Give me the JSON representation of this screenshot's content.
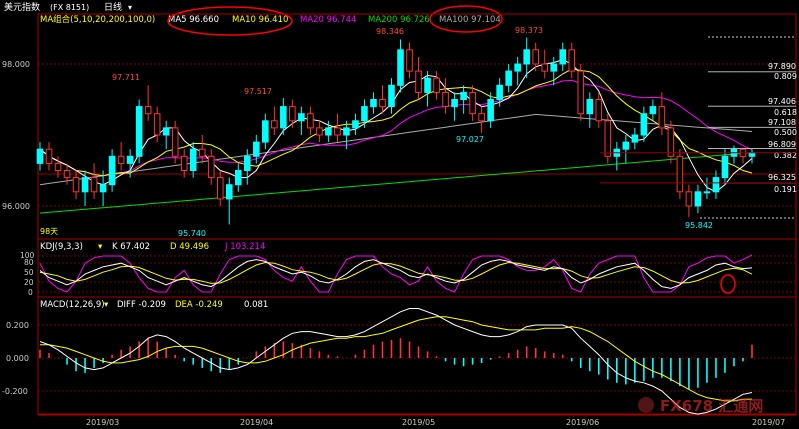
{
  "header": {
    "title": "美元指数",
    "code": "(FX 8151)",
    "period": "日线",
    "period_arrow": "▾"
  },
  "ma_legend": {
    "label": "MA组合(5,10,20,200,100,0)",
    "items": [
      {
        "text": "MA5 96.660",
        "color": "#ffffff"
      },
      {
        "text": "MA10 96.410",
        "color": "#ffff00"
      },
      {
        "text": "MA20 96.744",
        "color": "#ff00ff"
      },
      {
        "text": "MA200 96.726",
        "color": "#00dd00"
      },
      {
        "text": "MA100 97.104",
        "color": "#aaaaaa"
      }
    ]
  },
  "colors": {
    "up": "#00ffff",
    "down": "#ff3333",
    "ma5": "#ffffff",
    "ma10": "#ffff00",
    "ma20": "#ff00ff",
    "ma200": "#00dd00",
    "ma100": "#aaaaaa",
    "grid": "#7a0000",
    "border": "#aa0000",
    "circle": "#ff0000",
    "watermark": "#ff3333"
  },
  "fib_labels": [
    "97.890",
    "0.809",
    "97.406",
    "0.618",
    "97.108",
    "0.500",
    "96.809",
    "0.382",
    "96.325",
    "0.191"
  ],
  "annotations": [
    "98.346",
    "98.373",
    "97.711",
    "97.517",
    "97.027",
    "95.740",
    "95.842",
    "98天"
  ],
  "price_axis": [
    "98.000",
    "96.000"
  ],
  "kdj": {
    "label": "KDJ(9,3,3)",
    "k": "K 67.402",
    "d": "D 49.496",
    "j": "J 103.214",
    "axis": [
      "100",
      "80",
      "50",
      "20",
      "0"
    ]
  },
  "macd": {
    "label": "MACD(12,26,9)",
    "diff": "DIFF -0.209",
    "dea": "DEA -0.249",
    "value": "0.081",
    "axis": [
      "0.200",
      "0.000",
      "-0.200"
    ]
  },
  "time_axis": [
    "2019/03",
    "2019/04",
    "2019/05",
    "2019/06",
    "2019/07"
  ],
  "watermark": "FX678 汇通网",
  "chart_data": {
    "type": "candlestick",
    "ylim": [
      95.5,
      98.45
    ],
    "candles": [
      [
        96.6,
        96.9,
        96.5,
        96.8
      ],
      [
        96.8,
        96.9,
        96.5,
        96.6
      ],
      [
        96.6,
        96.7,
        96.4,
        96.5
      ],
      [
        96.5,
        96.6,
        96.3,
        96.4
      ],
      [
        96.4,
        96.5,
        96.1,
        96.2
      ],
      [
        96.2,
        96.5,
        96.0,
        96.4
      ],
      [
        96.4,
        96.6,
        96.1,
        96.2
      ],
      [
        96.2,
        96.5,
        96.0,
        96.3
      ],
      [
        96.3,
        96.8,
        96.2,
        96.7
      ],
      [
        96.7,
        96.9,
        96.5,
        96.6
      ],
      [
        96.6,
        96.8,
        96.4,
        96.7
      ],
      [
        96.7,
        97.5,
        96.6,
        97.4
      ],
      [
        97.4,
        97.7,
        97.2,
        97.3
      ],
      [
        97.3,
        97.4,
        96.9,
        97.0
      ],
      [
        97.0,
        97.2,
        96.8,
        97.1
      ],
      [
        97.1,
        97.2,
        96.6,
        96.7
      ],
      [
        96.7,
        96.8,
        96.4,
        96.5
      ],
      [
        96.5,
        96.9,
        96.4,
        96.8
      ],
      [
        96.8,
        97.0,
        96.6,
        96.7
      ],
      [
        96.7,
        96.8,
        96.3,
        96.4
      ],
      [
        96.4,
        96.5,
        96.0,
        96.1
      ],
      [
        96.1,
        96.4,
        95.74,
        96.3
      ],
      [
        96.3,
        96.6,
        96.2,
        96.5
      ],
      [
        96.5,
        96.8,
        96.3,
        96.7
      ],
      [
        96.7,
        97.0,
        96.6,
        96.9
      ],
      [
        96.9,
        97.3,
        96.8,
        97.2
      ],
      [
        97.2,
        97.4,
        97.0,
        97.1
      ],
      [
        97.1,
        97.52,
        97.0,
        97.4
      ],
      [
        97.4,
        97.5,
        97.1,
        97.2
      ],
      [
        97.2,
        97.4,
        97.0,
        97.3
      ],
      [
        97.3,
        97.4,
        97.0,
        97.1
      ],
      [
        97.1,
        97.2,
        96.9,
        97.0
      ],
      [
        97.0,
        97.2,
        96.9,
        97.1
      ],
      [
        97.1,
        97.3,
        96.9,
        97.0
      ],
      [
        97.0,
        97.2,
        96.8,
        97.1
      ],
      [
        97.1,
        97.3,
        97.0,
        97.2
      ],
      [
        97.2,
        97.5,
        97.1,
        97.4
      ],
      [
        97.4,
        97.6,
        97.3,
        97.5
      ],
      [
        97.5,
        97.7,
        97.3,
        97.4
      ],
      [
        97.4,
        97.8,
        97.3,
        97.7
      ],
      [
        97.7,
        98.346,
        97.6,
        98.2
      ],
      [
        98.2,
        98.3,
        97.8,
        97.9
      ],
      [
        97.9,
        98.1,
        97.5,
        97.6
      ],
      [
        97.6,
        97.9,
        97.4,
        97.8
      ],
      [
        97.8,
        97.9,
        97.5,
        97.6
      ],
      [
        97.6,
        97.8,
        97.3,
        97.4
      ],
      [
        97.4,
        97.6,
        97.2,
        97.5
      ],
      [
        97.5,
        97.7,
        97.3,
        97.6
      ],
      [
        97.6,
        97.7,
        97.2,
        97.3
      ],
      [
        97.3,
        97.4,
        97.03,
        97.2
      ],
      [
        97.2,
        97.6,
        97.1,
        97.5
      ],
      [
        97.5,
        97.8,
        97.4,
        97.7
      ],
      [
        97.7,
        98.0,
        97.6,
        97.9
      ],
      [
        97.9,
        98.1,
        97.7,
        98.0
      ],
      [
        98.0,
        98.373,
        97.8,
        98.2
      ],
      [
        98.2,
        98.3,
        97.9,
        98.0
      ],
      [
        98.0,
        98.2,
        97.8,
        97.9
      ],
      [
        97.9,
        98.1,
        97.7,
        98.0
      ],
      [
        98.0,
        98.3,
        97.9,
        98.2
      ],
      [
        98.2,
        98.3,
        97.8,
        97.9
      ],
      [
        97.9,
        98.0,
        97.2,
        97.3
      ],
      [
        97.3,
        97.6,
        97.1,
        97.5
      ],
      [
        97.5,
        97.6,
        97.1,
        97.2
      ],
      [
        97.2,
        97.3,
        96.6,
        96.7
      ],
      [
        96.7,
        96.9,
        96.5,
        96.8
      ],
      [
        96.8,
        97.0,
        96.6,
        96.9
      ],
      [
        96.9,
        97.1,
        96.8,
        97.0
      ],
      [
        97.0,
        97.4,
        96.9,
        97.3
      ],
      [
        97.3,
        97.5,
        97.2,
        97.4
      ],
      [
        97.4,
        97.6,
        97.0,
        97.1
      ],
      [
        97.1,
        97.2,
        96.6,
        96.7
      ],
      [
        96.7,
        96.8,
        96.1,
        96.2
      ],
      [
        96.2,
        96.3,
        95.842,
        96.0
      ],
      [
        96.0,
        96.3,
        95.9,
        96.2
      ],
      [
        96.2,
        96.4,
        96.1,
        96.2
      ],
      [
        96.2,
        96.5,
        96.1,
        96.4
      ],
      [
        96.4,
        96.8,
        96.3,
        96.7
      ],
      [
        96.7,
        96.85,
        96.6,
        96.8
      ],
      [
        96.8,
        96.82,
        96.6,
        96.7
      ],
      [
        96.7,
        96.8,
        96.6,
        96.75
      ]
    ],
    "kdj_k": [
      60,
      40,
      30,
      20,
      30,
      50,
      60,
      70,
      75,
      80,
      70,
      60,
      40,
      30,
      20,
      30,
      40,
      30,
      20,
      15,
      30,
      50,
      70,
      85,
      90,
      85,
      70,
      60,
      50,
      55,
      45,
      30,
      25,
      35,
      50,
      70,
      85,
      90,
      80,
      70,
      60,
      45,
      40,
      50,
      40,
      30,
      25,
      35,
      55,
      75,
      85,
      90,
      85,
      75,
      70,
      65,
      60,
      70,
      65,
      40,
      25,
      35,
      50,
      60,
      70,
      75,
      80,
      60,
      35,
      15,
      10,
      20,
      40,
      50,
      60,
      75,
      80,
      70,
      65,
      67
    ],
    "kdj_j": [
      80,
      30,
      10,
      0,
      30,
      80,
      95,
      100,
      100,
      100,
      80,
      40,
      10,
      0,
      0,
      40,
      60,
      20,
      0,
      0,
      50,
      90,
      100,
      100,
      100,
      90,
      60,
      40,
      30,
      70,
      30,
      0,
      0,
      50,
      90,
      100,
      100,
      100,
      70,
      50,
      40,
      20,
      30,
      70,
      30,
      10,
      0,
      50,
      90,
      100,
      100,
      100,
      90,
      70,
      60,
      60,
      70,
      90,
      60,
      10,
      0,
      50,
      80,
      90,
      100,
      100,
      100,
      40,
      0,
      0,
      0,
      20,
      70,
      80,
      95,
      100,
      100,
      80,
      90,
      103
    ],
    "kdj_d": [
      55,
      50,
      45,
      35,
      30,
      35,
      45,
      55,
      62,
      70,
      72,
      68,
      58,
      48,
      38,
      33,
      35,
      35,
      30,
      24,
      25,
      35,
      48,
      62,
      75,
      82,
      80,
      72,
      62,
      58,
      55,
      48,
      38,
      33,
      38,
      50,
      63,
      75,
      80,
      78,
      72,
      62,
      52,
      48,
      45,
      40,
      33,
      32,
      38,
      50,
      63,
      75,
      82,
      80,
      75,
      70,
      65,
      65,
      65,
      58,
      45,
      38,
      40,
      48,
      56,
      63,
      70,
      68,
      58,
      45,
      32,
      25,
      26,
      32,
      42,
      52,
      62,
      66,
      62,
      49.5
    ],
    "macd_hist": [
      0.05,
      0.03,
      0.0,
      -0.04,
      -0.08,
      -0.09,
      -0.06,
      -0.03,
      0.02,
      0.05,
      0.07,
      0.1,
      0.12,
      0.1,
      0.06,
      0.02,
      -0.02,
      -0.04,
      -0.06,
      -0.08,
      -0.09,
      -0.07,
      -0.04,
      0.0,
      0.04,
      0.07,
      0.09,
      0.1,
      0.09,
      0.08,
      0.06,
      0.04,
      0.02,
      0.01,
      0.0,
      0.02,
      0.05,
      0.08,
      0.1,
      0.11,
      0.12,
      0.1,
      0.07,
      0.04,
      0.01,
      -0.02,
      -0.04,
      -0.05,
      -0.04,
      -0.03,
      -0.01,
      0.01,
      0.03,
      0.05,
      0.07,
      0.06,
      0.04,
      0.03,
      0.02,
      -0.02,
      -0.06,
      -0.08,
      -0.1,
      -0.13,
      -0.15,
      -0.16,
      -0.15,
      -0.14,
      -0.12,
      -0.12,
      -0.14,
      -0.17,
      -0.19,
      -0.18,
      -0.15,
      -0.12,
      -0.09,
      -0.05,
      -0.02,
      0.081
    ],
    "macd_diff": [
      0.1,
      0.08,
      0.05,
      0.01,
      -0.03,
      -0.06,
      -0.07,
      -0.06,
      -0.03,
      0.0,
      0.03,
      0.07,
      0.12,
      0.14,
      0.13,
      0.1,
      0.06,
      0.03,
      0.0,
      -0.03,
      -0.06,
      -0.07,
      -0.06,
      -0.04,
      0.0,
      0.04,
      0.08,
      0.12,
      0.15,
      0.16,
      0.16,
      0.15,
      0.14,
      0.13,
      0.13,
      0.14,
      0.16,
      0.19,
      0.22,
      0.25,
      0.28,
      0.3,
      0.3,
      0.28,
      0.26,
      0.23,
      0.2,
      0.18,
      0.16,
      0.14,
      0.13,
      0.13,
      0.14,
      0.16,
      0.19,
      0.2,
      0.2,
      0.2,
      0.2,
      0.18,
      0.12,
      0.07,
      0.02,
      -0.04,
      -0.09,
      -0.12,
      -0.14,
      -0.15,
      -0.17,
      -0.2,
      -0.25,
      -0.3,
      -0.33,
      -0.34,
      -0.33,
      -0.31,
      -0.28,
      -0.25,
      -0.22,
      -0.209
    ],
    "macd_dea": [
      0.08,
      0.08,
      0.07,
      0.06,
      0.04,
      0.02,
      0.0,
      -0.02,
      -0.03,
      -0.03,
      -0.02,
      -0.01,
      0.01,
      0.04,
      0.06,
      0.07,
      0.07,
      0.07,
      0.06,
      0.04,
      0.02,
      0.0,
      -0.02,
      -0.03,
      -0.03,
      -0.02,
      0.0,
      0.02,
      0.05,
      0.07,
      0.09,
      0.1,
      0.11,
      0.12,
      0.12,
      0.13,
      0.13,
      0.14,
      0.15,
      0.17,
      0.19,
      0.21,
      0.23,
      0.24,
      0.25,
      0.25,
      0.24,
      0.23,
      0.22,
      0.2,
      0.19,
      0.18,
      0.17,
      0.17,
      0.17,
      0.17,
      0.18,
      0.18,
      0.18,
      0.19,
      0.18,
      0.16,
      0.13,
      0.1,
      0.06,
      0.02,
      -0.02,
      -0.05,
      -0.08,
      -0.1,
      -0.13,
      -0.16,
      -0.19,
      -0.22,
      -0.24,
      -0.25,
      -0.26,
      -0.26,
      -0.25,
      -0.249
    ],
    "fib_levels": [
      97.89,
      97.406,
      97.108,
      96.809,
      96.325
    ],
    "fib_ratios": [
      0.809,
      0.618,
      0.5,
      0.382,
      0.191
    ],
    "horizontal_levels": [
      96.75,
      96.325
    ]
  }
}
